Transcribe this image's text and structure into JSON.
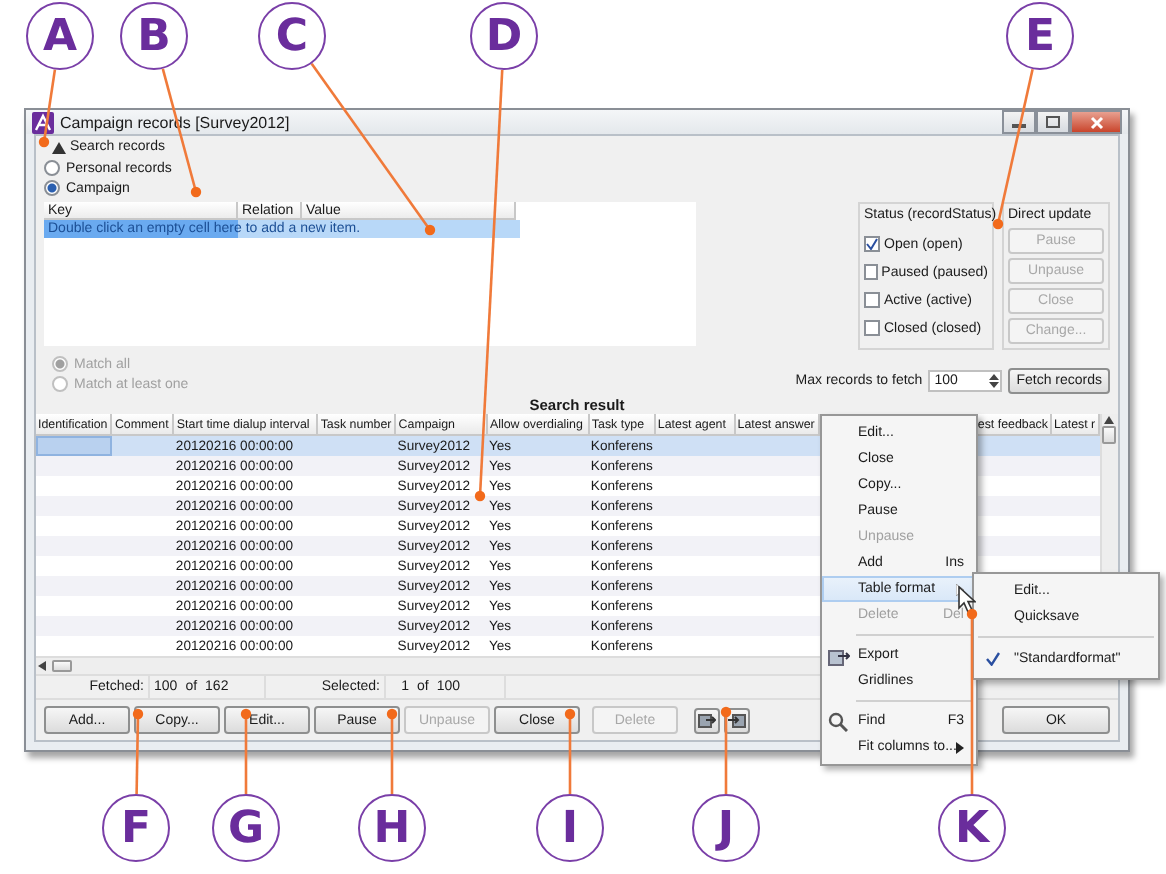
{
  "window": {
    "title": "Campaign records [Survey2012]"
  },
  "search_records": {
    "title": "Search records",
    "expanded": true,
    "scope_options": [
      {
        "label": "Personal records",
        "selected": false
      },
      {
        "label": "Campaign",
        "selected": true
      }
    ],
    "criteria_table": {
      "columns": [
        "Key",
        "Relation",
        "Value"
      ],
      "hint": "Double click an empty cell here to add a new item."
    },
    "match_options": [
      {
        "label": "Match all",
        "selected": true,
        "disabled": true
      },
      {
        "label": "Match at least one",
        "selected": false,
        "disabled": true
      }
    ],
    "status": {
      "title": "Status (recordStatus)",
      "options": [
        {
          "label": "Open (open)",
          "checked": true
        },
        {
          "label": "Paused (paused)",
          "checked": false
        },
        {
          "label": "Active (active)",
          "checked": false
        },
        {
          "label": "Closed (closed)",
          "checked": false
        }
      ]
    },
    "direct_update": {
      "title": "Direct update",
      "buttons": [
        {
          "label": "Pause",
          "disabled": true
        },
        {
          "label": "Unpause",
          "disabled": true
        },
        {
          "label": "Close",
          "disabled": true
        },
        {
          "label": "Change...",
          "disabled": true
        }
      ]
    },
    "max_records": {
      "label": "Max records to fetch",
      "value": "100"
    },
    "fetch_button": "Fetch records"
  },
  "search_result": {
    "title": "Search result",
    "columns": [
      "Identification",
      "Comment",
      "Start time dialup interval",
      "Task number",
      "Campaign",
      "Allow overdialing",
      "Task type",
      "Latest agent",
      "Latest answer",
      "est feedback",
      "Latest r"
    ],
    "rows": [
      {
        "start_time": "20120216 00:00:00",
        "campaign": "Survey2012",
        "allow_overdialing": "Yes",
        "task_type": "Konferens",
        "selected": true
      },
      {
        "start_time": "20120216 00:00:00",
        "campaign": "Survey2012",
        "allow_overdialing": "Yes",
        "task_type": "Konferens",
        "selected": false
      },
      {
        "start_time": "20120216 00:00:00",
        "campaign": "Survey2012",
        "allow_overdialing": "Yes",
        "task_type": "Konferens",
        "selected": false
      },
      {
        "start_time": "20120216 00:00:00",
        "campaign": "Survey2012",
        "allow_overdialing": "Yes",
        "task_type": "Konferens",
        "selected": false
      },
      {
        "start_time": "20120216 00:00:00",
        "campaign": "Survey2012",
        "allow_overdialing": "Yes",
        "task_type": "Konferens",
        "selected": false
      },
      {
        "start_time": "20120216 00:00:00",
        "campaign": "Survey2012",
        "allow_overdialing": "Yes",
        "task_type": "Konferens",
        "selected": false
      },
      {
        "start_time": "20120216 00:00:00",
        "campaign": "Survey2012",
        "allow_overdialing": "Yes",
        "task_type": "Konferens",
        "selected": false
      },
      {
        "start_time": "20120216 00:00:00",
        "campaign": "Survey2012",
        "allow_overdialing": "Yes",
        "task_type": "Konferens",
        "selected": false
      },
      {
        "start_time": "20120216 00:00:00",
        "campaign": "Survey2012",
        "allow_overdialing": "Yes",
        "task_type": "Konferens",
        "selected": false
      },
      {
        "start_time": "20120216 00:00:00",
        "campaign": "Survey2012",
        "allow_overdialing": "Yes",
        "task_type": "Konferens",
        "selected": false
      },
      {
        "start_time": "20120216 00:00:00",
        "campaign": "Survey2012",
        "allow_overdialing": "Yes",
        "task_type": "Konferens",
        "selected": false
      }
    ]
  },
  "status_line": {
    "fetched_label": "Fetched:",
    "fetched": "100",
    "fetched_of": "of",
    "fetched_total": "162",
    "selected_label": "Selected:",
    "selected": "1",
    "selected_of": "of",
    "selected_total": "100"
  },
  "buttons": [
    {
      "kind": "text",
      "label": "Add...",
      "disabled": false
    },
    {
      "kind": "text",
      "label": "Copy...",
      "disabled": false
    },
    {
      "kind": "text",
      "label": "Edit...",
      "disabled": false
    },
    {
      "kind": "text",
      "label": "Pause",
      "disabled": false
    },
    {
      "kind": "text",
      "label": "Unpause",
      "disabled": true
    },
    {
      "kind": "text",
      "label": "Close",
      "disabled": false
    },
    {
      "kind": "text",
      "label": "Delete",
      "disabled": true
    },
    {
      "kind": "export",
      "disabled": false
    },
    {
      "kind": "import",
      "disabled": false
    }
  ],
  "ok_button": "OK",
  "context_menu": {
    "items": [
      {
        "kind": "item",
        "label": "Edit...",
        "disabled": false,
        "selected": false,
        "has_submenu": false
      },
      {
        "kind": "item",
        "label": "Close",
        "disabled": false,
        "selected": false,
        "has_submenu": false
      },
      {
        "kind": "item",
        "label": "Copy...",
        "disabled": false,
        "selected": false,
        "has_submenu": false
      },
      {
        "kind": "item",
        "label": "Pause",
        "disabled": false,
        "selected": false,
        "has_submenu": false
      },
      {
        "kind": "item",
        "label": "Unpause",
        "disabled": true,
        "selected": false,
        "has_submenu": false
      },
      {
        "kind": "item",
        "label": "Add",
        "shortcut": "Ins",
        "disabled": false,
        "selected": false,
        "has_submenu": false
      },
      {
        "kind": "item",
        "label": "Table format",
        "disabled": false,
        "selected": true,
        "has_submenu": true
      },
      {
        "kind": "item",
        "label": "Delete",
        "shortcut": "Del",
        "disabled": true,
        "selected": false,
        "has_submenu": false
      },
      {
        "kind": "separator"
      },
      {
        "kind": "export",
        "label": "Export",
        "disabled": false,
        "selected": false,
        "has_submenu": false
      },
      {
        "kind": "item",
        "label": "Gridlines",
        "disabled": false,
        "selected": false,
        "has_submenu": false
      },
      {
        "kind": "separator"
      },
      {
        "kind": "find",
        "label": "Find",
        "shortcut": "F3",
        "disabled": false,
        "selected": false,
        "has_submenu": false
      },
      {
        "kind": "item",
        "label": "Fit columns to...",
        "disabled": false,
        "selected": false,
        "has_submenu": true
      }
    ]
  },
  "submenu": {
    "items": [
      {
        "kind": "item",
        "label": "Edit...",
        "checked": false
      },
      {
        "kind": "item",
        "label": "Quicksave",
        "checked": false
      },
      {
        "kind": "separator"
      },
      {
        "kind": "item",
        "label": "\"Standardformat\"",
        "checked": true
      }
    ]
  },
  "callouts": [
    {
      "letter": "A"
    },
    {
      "letter": "B"
    },
    {
      "letter": "C"
    },
    {
      "letter": "D"
    },
    {
      "letter": "E"
    },
    {
      "letter": "F"
    },
    {
      "letter": "G"
    },
    {
      "letter": "H"
    },
    {
      "letter": "I"
    },
    {
      "letter": "J"
    },
    {
      "letter": "K"
    }
  ]
}
